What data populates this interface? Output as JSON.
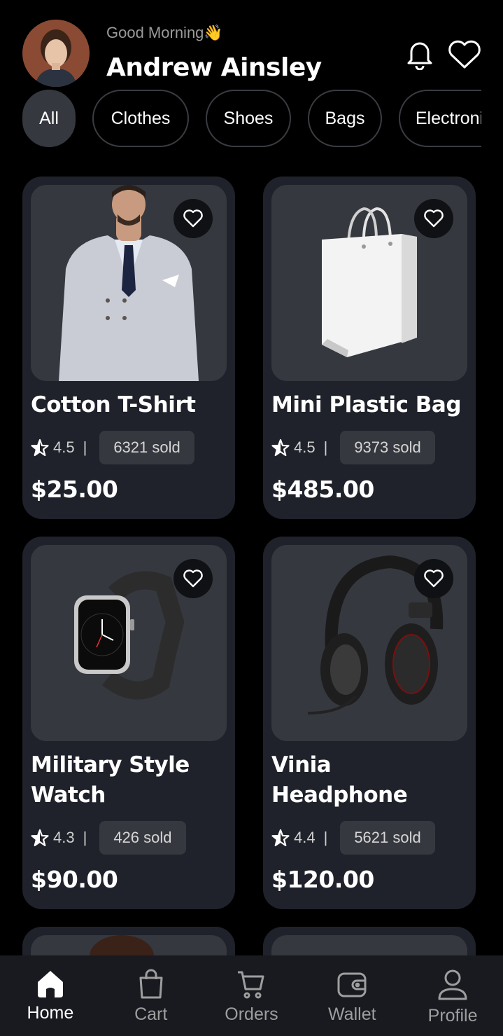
{
  "header": {
    "greeting": "Good Morning👋",
    "username": "Andrew Ainsley",
    "icons": [
      "bell-icon",
      "heart-icon"
    ]
  },
  "categories": [
    "All",
    "Clothes",
    "Shoes",
    "Bags",
    "Electronics"
  ],
  "active_category": "All",
  "products": [
    {
      "name": "Cotton T-Shirt",
      "rating": "4.5",
      "sold": "6321 sold",
      "price": "$25.00"
    },
    {
      "name": "Mini Plastic Bag",
      "rating": "4.5",
      "sold": "9373 sold",
      "price": "$485.00"
    },
    {
      "name": "Military Style Watch",
      "rating": "4.3",
      "sold": "426 sold",
      "price": "$90.00"
    },
    {
      "name": "Vinia Headphone",
      "rating": "4.4",
      "sold": "5621 sold",
      "price": "$120.00"
    }
  ],
  "nav": [
    {
      "label": "Home",
      "icon": "home-icon",
      "active": true
    },
    {
      "label": "Cart",
      "icon": "bag-icon",
      "active": false
    },
    {
      "label": "Orders",
      "icon": "cart-icon",
      "active": false
    },
    {
      "label": "Wallet",
      "icon": "wallet-icon",
      "active": false
    },
    {
      "label": "Profile",
      "icon": "profile-icon",
      "active": false
    }
  ],
  "colors": {
    "background": "#000000",
    "card": "#1f222a",
    "image_bg": "#35383f",
    "nav_bg": "#181a20"
  }
}
